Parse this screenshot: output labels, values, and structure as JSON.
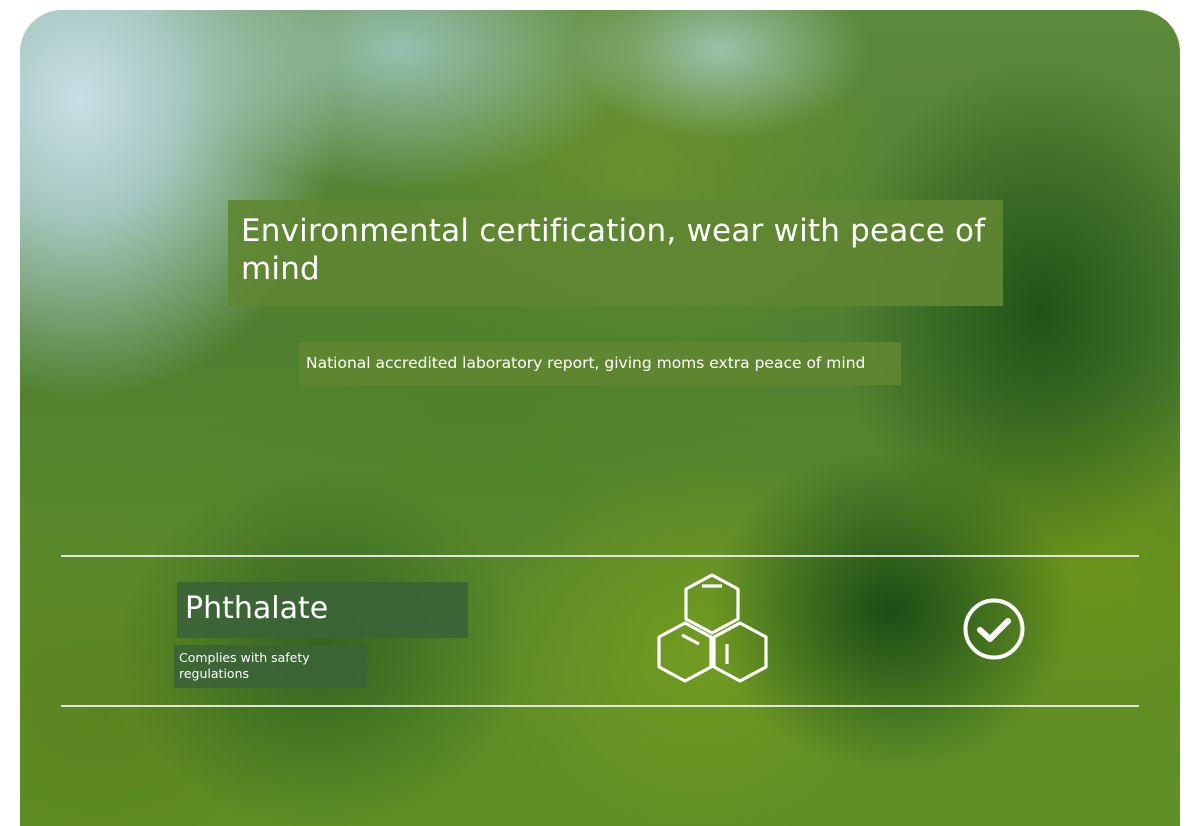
{
  "hero": {
    "title": "Environmental certification, wear with peace of mind",
    "subtitle": "National accredited laboratory report, giving moms extra peace of mind"
  },
  "feature": {
    "name": "Phthalate",
    "description": "Complies with safety regulations",
    "icon": "molecule-hexagon-icon",
    "status_icon": "checkmark-circle-icon"
  },
  "colors": {
    "text": "#ffffff",
    "title_box": "#5f8732",
    "feature_box": "#3c6437",
    "divider": "#f0f0f0"
  }
}
